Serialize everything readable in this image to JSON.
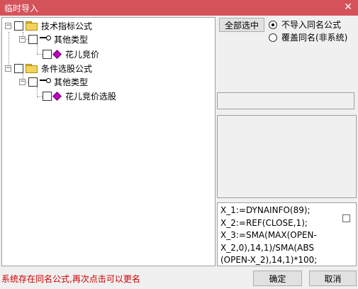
{
  "window": {
    "title": "临时导入",
    "close_glyph": "✕"
  },
  "tree": {
    "nodes": [
      {
        "label": "技术指标公式",
        "level": 0,
        "type": "folder"
      },
      {
        "label": "其他类型",
        "level": 1,
        "type": "category"
      },
      {
        "label": "花儿竞价",
        "level": 2,
        "type": "formula"
      },
      {
        "label": "条件选股公式",
        "level": 0,
        "type": "folder"
      },
      {
        "label": "其他类型",
        "level": 1,
        "type": "category"
      },
      {
        "label": "花儿竞价选股",
        "level": 2,
        "type": "formula"
      }
    ]
  },
  "options": {
    "select_all_label": "全部选中",
    "radio_no_import": "不导入同名公式",
    "radio_overwrite": "覆盖同名(非系统)",
    "selected": "radio_no_import"
  },
  "formula_preview": {
    "lines": [
      "X_1:=DYNAINFO(89);",
      "X_2:=REF(CLOSE,1);",
      "X_3:=SMA(MAX(OPEN-",
      "X_2,0),14,1)/SMA(ABS",
      "(OPEN-X_2),14,1)*100;"
    ]
  },
  "status_message": "系统存在同名公式,再次点击可以更名",
  "buttons": {
    "ok": "确定",
    "cancel": "取消"
  }
}
